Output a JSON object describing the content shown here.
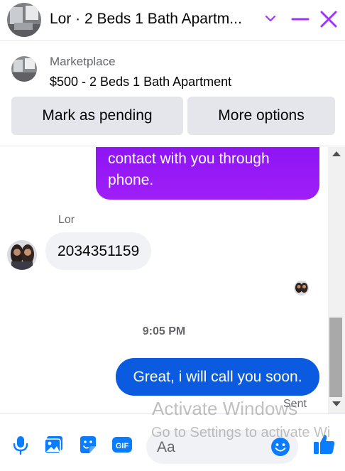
{
  "header": {
    "title": "Lor · 2 Beds 1 Bath Apartm...",
    "accent": "#a033ff"
  },
  "listing": {
    "source_label": "Marketplace",
    "item_title": "$500 - 2 Beds 1 Bath Apartment",
    "mark_pending_label": "Mark as pending",
    "more_options_label": "More options"
  },
  "messages": {
    "outgoing_partial": "contact with you through phone.",
    "sender_name": "Lor",
    "incoming_text": "2034351159",
    "timestamp": "9:05 PM",
    "outgoing_text": "Great, i will call you soon.",
    "status": "Sent",
    "colors": {
      "purple": "#9016f6",
      "blue": "#0a5be0",
      "incoming_bg": "#f0f2f5"
    }
  },
  "composer": {
    "placeholder": "Aa",
    "icons": [
      "microphone-icon",
      "photo-icon",
      "sticker-icon",
      "gif-icon",
      "emoji-icon",
      "thumbs-up-icon"
    ],
    "icon_color": "#0a7cff"
  },
  "watermark": {
    "line1": "Activate Windows",
    "line2": "Go to Settings to activate Wi"
  }
}
